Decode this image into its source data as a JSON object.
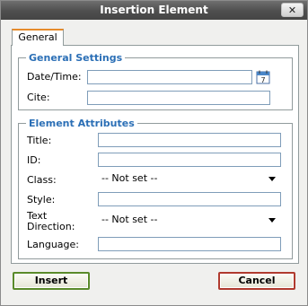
{
  "dialog": {
    "title": "Insertion Element",
    "close_glyph": "✕"
  },
  "tabs": [
    {
      "label": "General",
      "active": true
    }
  ],
  "general_settings": {
    "legend": "General Settings",
    "datetime_label": "Date/Time:",
    "datetime_value": "",
    "calendar_icon": "calendar-icon",
    "cite_label": "Cite:",
    "cite_value": ""
  },
  "element_attributes": {
    "legend": "Element Attributes",
    "title_label": "Title:",
    "title_value": "",
    "id_label": "ID:",
    "id_value": "",
    "class_label": "Class:",
    "class_selected": "-- Not set --",
    "style_label": "Style:",
    "style_value": "",
    "text_direction_label_line1": "Text",
    "text_direction_label_line2": "Direction:",
    "text_direction_selected": "-- Not set --",
    "language_label": "Language:",
    "language_value": ""
  },
  "buttons": {
    "insert_label": "Insert",
    "cancel_label": "Cancel"
  },
  "colors": {
    "legend_text": "#2b6fb6",
    "titlebar": "#4e4e4e",
    "insert_border": "#5a8a2a",
    "cancel_border": "#b03a2e",
    "tab_accent": "#e68b2c"
  }
}
